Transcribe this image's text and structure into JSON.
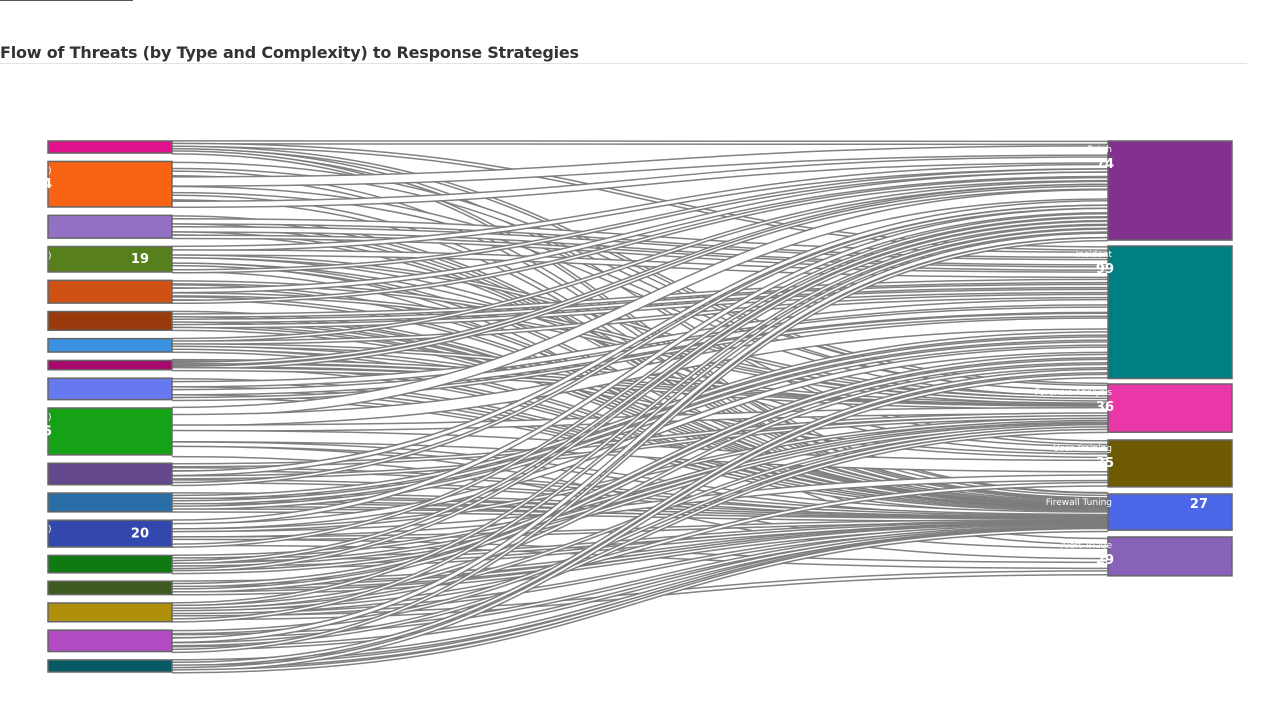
{
  "header": {
    "title": "Flow of Threats (by Type and Complexity) to Response Strategies"
  },
  "chart_data": {
    "type": "sankey",
    "title": "Flow of Threats (by Type and Complexity) to Response Strategies",
    "link_color": "#7a7a7a",
    "node_border": "#666666",
    "sources": [
      {
        "label": "",
        "value": 9,
        "color": "#e0138c"
      },
      {
        "label": "",
        "value": 34,
        "color": "#f86314"
      },
      {
        "label": "",
        "value": 17,
        "color": "#9370c4"
      },
      {
        "label": "",
        "value": 19,
        "color": "#577f1c"
      },
      {
        "label": "",
        "value": 17,
        "color": "#cf5114"
      },
      {
        "label": "",
        "value": 14,
        "color": "#983a0b"
      },
      {
        "label": "",
        "value": 10,
        "color": "#3a92e0"
      },
      {
        "label": "",
        "value": 7,
        "color": "#a8076b"
      },
      {
        "label": "",
        "value": 16,
        "color": "#6679f0"
      },
      {
        "label": "",
        "value": 35,
        "color": "#16a216"
      },
      {
        "label": "",
        "value": 16,
        "color": "#63488b"
      },
      {
        "label": "",
        "value": 14,
        "color": "#2a6ea7"
      },
      {
        "label": "",
        "value": 20,
        "color": "#3348af"
      },
      {
        "label": "",
        "value": 13,
        "color": "#0e7a11"
      },
      {
        "label": "",
        "value": 10,
        "color": "#3d5b1e"
      },
      {
        "label": "",
        "value": 14,
        "color": "#ad8f0a"
      },
      {
        "label": "",
        "value": 16,
        "color": "#b04bc3"
      },
      {
        "label": "",
        "value": 9,
        "color": "#065a63"
      }
    ],
    "source_value_labels": [
      {
        "node": 1,
        "text": "4"
      },
      {
        "node": 3,
        "text": "19"
      },
      {
        "node": 9,
        "text": "5"
      },
      {
        "node": 12,
        "text": "20"
      }
    ],
    "source_small_labels": [
      {
        "node": 1,
        "text": ")"
      },
      {
        "node": 3,
        "text": ")"
      },
      {
        "node": 9,
        "text": ")"
      },
      {
        "node": 12,
        "text": ")"
      }
    ],
    "targets": [
      {
        "label": "Patch",
        "value": 74,
        "color": "#82318e"
      },
      {
        "label": "Incident",
        "value": 99,
        "color": "#007f83"
      },
      {
        "label": "Forensic Analysis",
        "value": 36,
        "color": "#e937a7"
      },
      {
        "label": "User Training",
        "value": 35,
        "color": "#6e5a00"
      },
      {
        "label": "Firewall Tuning",
        "value": 27,
        "color": "#4c66e8"
      },
      {
        "label": "Alert Triage",
        "value": 29,
        "color": "#8861b9"
      }
    ],
    "target_value_labels": [
      "74",
      "99",
      "36",
      "35",
      "27",
      "29"
    ]
  }
}
